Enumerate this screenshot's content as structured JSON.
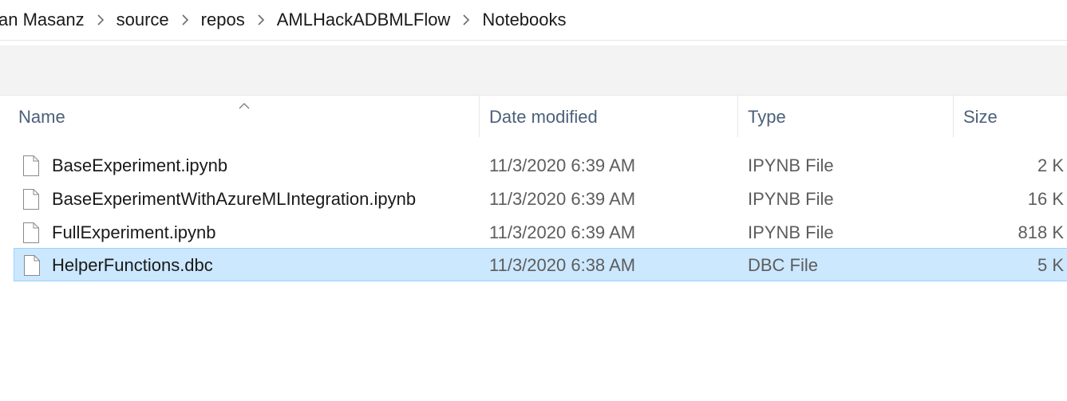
{
  "breadcrumb": {
    "items": [
      "an Masanz",
      "source",
      "repos",
      "AMLHackADBMLFlow",
      "Notebooks"
    ]
  },
  "columns": {
    "name": "Name",
    "date_modified": "Date modified",
    "type": "Type",
    "size": "Size"
  },
  "files": [
    {
      "name": "BaseExperiment.ipynb",
      "date": "11/3/2020 6:39 AM",
      "type": "IPYNB File",
      "size": "2 K",
      "selected": false
    },
    {
      "name": "BaseExperimentWithAzureMLIntegration.ipynb",
      "date": "11/3/2020 6:39 AM",
      "type": "IPYNB File",
      "size": "16 K",
      "selected": false
    },
    {
      "name": "FullExperiment.ipynb",
      "date": "11/3/2020 6:39 AM",
      "type": "IPYNB File",
      "size": "818 K",
      "selected": false
    },
    {
      "name": "HelperFunctions.dbc",
      "date": "11/3/2020 6:38 AM",
      "type": "DBC File",
      "size": "5 K",
      "selected": true
    }
  ],
  "colors": {
    "selection_bg": "#cce8ff",
    "selection_border": "#99d1ff",
    "header_text": "#4c607a"
  },
  "icons": {
    "breadcrumb_separator": "chevron-right-icon",
    "file": "document-icon",
    "sort": "sort-ascending-icon"
  }
}
